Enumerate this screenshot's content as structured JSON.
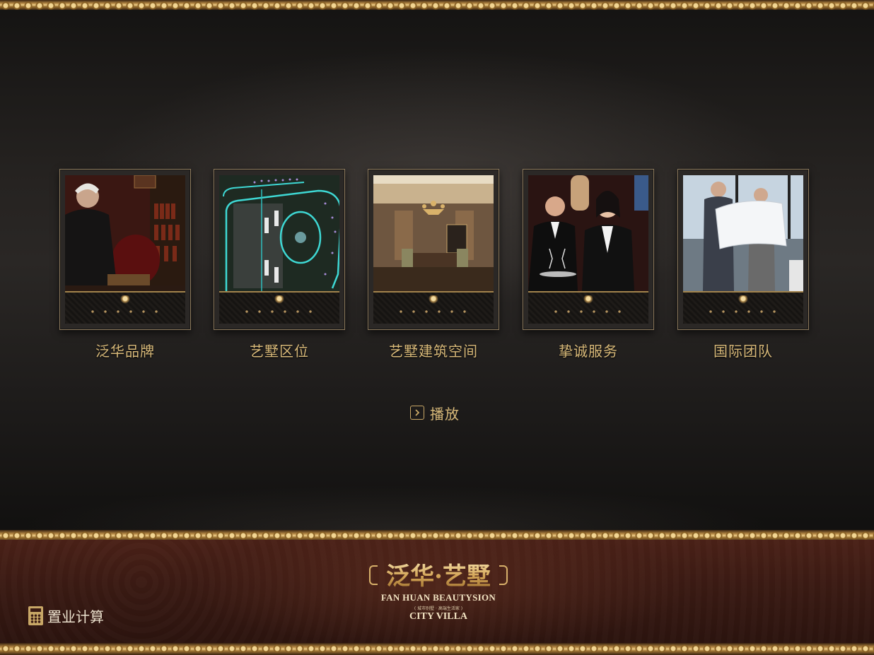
{
  "menu": {
    "items": [
      {
        "label": "泛华品牌",
        "thumb": "brand-gentleman-photo"
      },
      {
        "label": "艺墅区位",
        "thumb": "site-plan-map"
      },
      {
        "label": "艺墅建筑空间",
        "thumb": "interior-living-room-photo"
      },
      {
        "label": "挚诚服务",
        "thumb": "service-staff-photo"
      },
      {
        "label": "国际团队",
        "thumb": "team-blueprint-photo"
      }
    ]
  },
  "play": {
    "label": "播放",
    "icon": "play-square-icon"
  },
  "logo": {
    "cn": "泛华·艺墅",
    "en": "FAN HUAN BEAUTYSION",
    "sub": "( 城市别墅 · 高端生活家 )",
    "en2": "CITY VILLA"
  },
  "footer": {
    "calc_label": "置业计算",
    "calc_icon": "calculator-icon"
  },
  "colors": {
    "gold": "#d8b979",
    "band": "#3a1a13"
  }
}
